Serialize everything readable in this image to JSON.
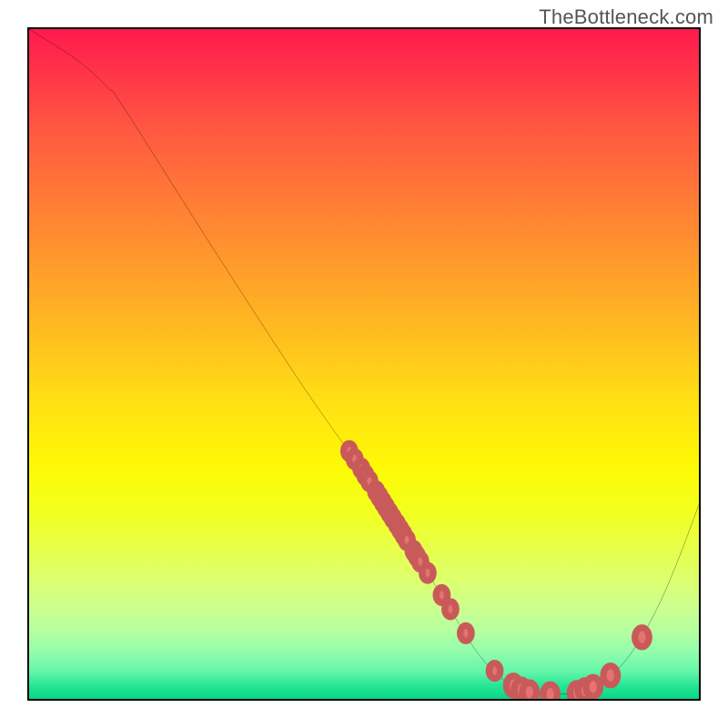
{
  "watermark": "TheBottleneck.com",
  "chart_data": {
    "type": "line",
    "title": "",
    "xlabel": "",
    "ylabel": "",
    "xlim": [
      0,
      100
    ],
    "ylim": [
      0,
      100
    ],
    "grid": false,
    "legend": false,
    "curve": [
      {
        "x": 0,
        "y": 100
      },
      {
        "x": 4,
        "y": 97.5
      },
      {
        "x": 7,
        "y": 95.5
      },
      {
        "x": 10,
        "y": 93.0
      },
      {
        "x": 12,
        "y": 91.0
      },
      {
        "x": 14,
        "y": 88.5
      },
      {
        "x": 27,
        "y": 68.0
      },
      {
        "x": 40,
        "y": 48.0
      },
      {
        "x": 48,
        "y": 36.5
      },
      {
        "x": 55,
        "y": 26.0
      },
      {
        "x": 60,
        "y": 18.0
      },
      {
        "x": 64,
        "y": 11.5
      },
      {
        "x": 67,
        "y": 6.8
      },
      {
        "x": 70,
        "y": 3.5
      },
      {
        "x": 73,
        "y": 1.6
      },
      {
        "x": 76,
        "y": 0.8
      },
      {
        "x": 79,
        "y": 0.7
      },
      {
        "x": 82,
        "y": 1.0
      },
      {
        "x": 85,
        "y": 2.0
      },
      {
        "x": 88,
        "y": 4.5
      },
      {
        "x": 91,
        "y": 8.5
      },
      {
        "x": 94,
        "y": 14.0
      },
      {
        "x": 97,
        "y": 21.0
      },
      {
        "x": 100,
        "y": 29.0
      }
    ],
    "markers": [
      {
        "x": 47.8,
        "y": 37.0,
        "r": 1.2
      },
      {
        "x": 48.6,
        "y": 35.8,
        "r": 1.2
      },
      {
        "x": 49.6,
        "y": 34.4,
        "r": 1.2
      },
      {
        "x": 50.2,
        "y": 33.4,
        "r": 1.2
      },
      {
        "x": 50.8,
        "y": 32.5,
        "r": 1.2
      },
      {
        "x": 51.8,
        "y": 31.0,
        "r": 1.2
      },
      {
        "x": 52.3,
        "y": 30.2,
        "r": 1.2
      },
      {
        "x": 52.8,
        "y": 29.4,
        "r": 1.2
      },
      {
        "x": 53.3,
        "y": 28.6,
        "r": 1.2
      },
      {
        "x": 53.8,
        "y": 27.8,
        "r": 1.2
      },
      {
        "x": 54.3,
        "y": 27.0,
        "r": 1.2
      },
      {
        "x": 54.9,
        "y": 26.1,
        "r": 1.2
      },
      {
        "x": 55.4,
        "y": 25.3,
        "r": 1.2
      },
      {
        "x": 55.9,
        "y": 24.5,
        "r": 1.2
      },
      {
        "x": 56.4,
        "y": 23.7,
        "r": 1.2
      },
      {
        "x": 57.4,
        "y": 22.1,
        "r": 1.2
      },
      {
        "x": 57.9,
        "y": 21.3,
        "r": 1.2
      },
      {
        "x": 58.4,
        "y": 20.5,
        "r": 1.2
      },
      {
        "x": 59.5,
        "y": 18.8,
        "r": 1.2
      },
      {
        "x": 61.6,
        "y": 15.5,
        "r": 1.2
      },
      {
        "x": 62.9,
        "y": 13.4,
        "r": 1.2
      },
      {
        "x": 65.2,
        "y": 9.8,
        "r": 1.2
      },
      {
        "x": 69.5,
        "y": 4.2,
        "r": 1.2
      },
      {
        "x": 72.3,
        "y": 2.0,
        "r": 1.5
      },
      {
        "x": 73.5,
        "y": 1.4,
        "r": 1.5
      },
      {
        "x": 74.7,
        "y": 1.0,
        "r": 1.5
      },
      {
        "x": 77.8,
        "y": 0.7,
        "r": 1.5
      },
      {
        "x": 81.8,
        "y": 0.9,
        "r": 1.5
      },
      {
        "x": 83.0,
        "y": 1.3,
        "r": 1.5
      },
      {
        "x": 84.2,
        "y": 1.8,
        "r": 1.5
      },
      {
        "x": 86.8,
        "y": 3.5,
        "r": 1.5
      },
      {
        "x": 91.5,
        "y": 9.2,
        "r": 1.5
      }
    ],
    "marker_color": "#e67272"
  }
}
